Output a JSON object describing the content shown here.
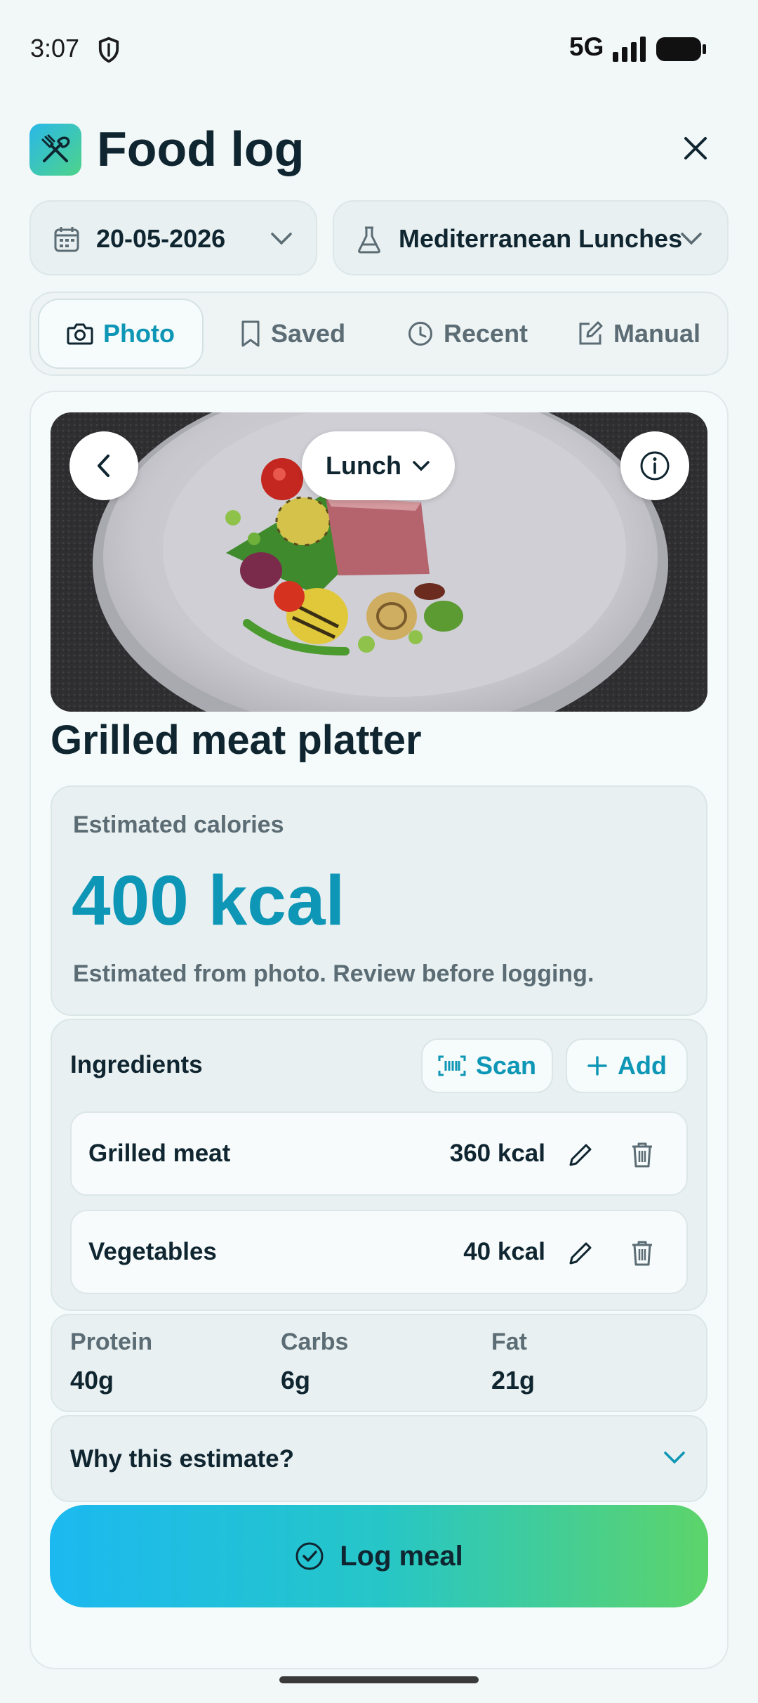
{
  "status_bar": {
    "time": "3:07",
    "network": "5G"
  },
  "header": {
    "title": "Food log"
  },
  "pickers": {
    "date": "20-05-2026",
    "plan": "Mediterranean Lunches"
  },
  "tabs": [
    {
      "label": "Photo",
      "icon": "camera-icon",
      "active": true
    },
    {
      "label": "Saved",
      "icon": "bookmark-icon",
      "active": false
    },
    {
      "label": "Recent",
      "icon": "clock-icon",
      "active": false
    },
    {
      "label": "Manual",
      "icon": "edit-icon",
      "active": false
    }
  ],
  "photo": {
    "meal_type": "Lunch"
  },
  "food": {
    "name": "Grilled meat platter"
  },
  "calories": {
    "label": "Estimated calories",
    "value": "400 kcal",
    "note": "Estimated from photo. Review before logging."
  },
  "ingredients": {
    "title": "Ingredients",
    "scan_label": "Scan",
    "add_label": "Add",
    "items": [
      {
        "name": "Grilled meat",
        "kcal": "360 kcal"
      },
      {
        "name": "Vegetables",
        "kcal": "40 kcal"
      }
    ]
  },
  "macros": [
    {
      "label": "Protein",
      "value": "40g"
    },
    {
      "label": "Carbs",
      "value": "6g"
    },
    {
      "label": "Fat",
      "value": "21g"
    }
  ],
  "why": {
    "label": "Why this estimate?"
  },
  "log_button": {
    "label": "Log meal"
  },
  "colors": {
    "accent": "#0d96b5",
    "background": "#f2f7f7",
    "gradient_start": "#1bb9f0",
    "gradient_end": "#5dd46a"
  }
}
